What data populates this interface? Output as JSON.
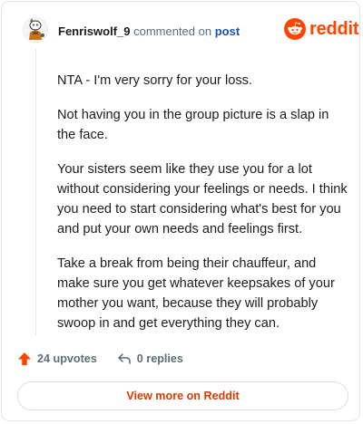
{
  "header": {
    "username": "Fenriswolf_9",
    "verb": "commented on",
    "post_link": "post"
  },
  "logo": {
    "text": "reddit",
    "brand_color": "#ff4500"
  },
  "comment": {
    "paragraphs": [
      "NTA - I'm very sorry for your loss.",
      "Not having you in the group picture is a slap in the face.",
      "Your sisters seem like they use you for a lot without considering your feelings or needs. I think you need to start considering what's best for you and put your own needs and feelings first.",
      "Take a break from being their chauffeur, and make sure you get whatever keepsakes of your mother you want, because they will probably swoop in and get everything they can."
    ]
  },
  "footer": {
    "upvotes": "24 upvotes",
    "replies": "0 replies",
    "upvote_color": "#ff4500"
  },
  "view_more": {
    "label": "View more on Reddit",
    "color": "#d93a00"
  },
  "icons": [
    "avatar",
    "reddit-snoo-icon",
    "upvote-arrow-icon",
    "reply-icon"
  ]
}
